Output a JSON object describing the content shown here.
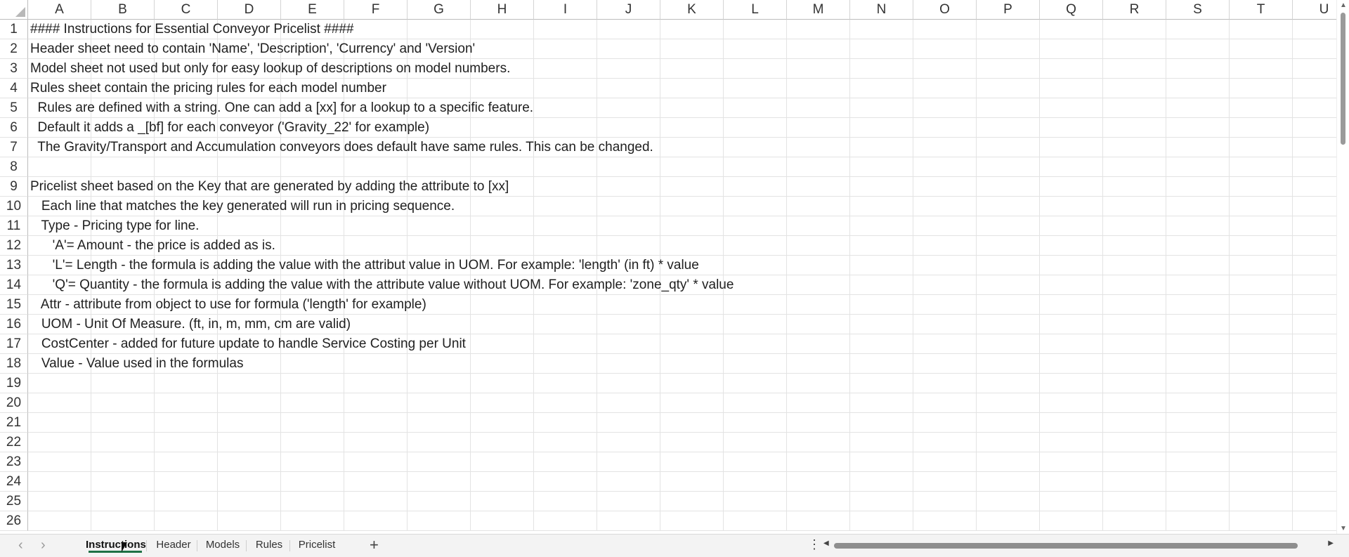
{
  "grid": {
    "columns": [
      "A",
      "B",
      "C",
      "D",
      "E",
      "F",
      "G",
      "H",
      "I",
      "J",
      "K",
      "L",
      "M",
      "N",
      "O",
      "P",
      "Q",
      "R",
      "S",
      "T",
      "U"
    ],
    "rows": [
      {
        "num": "1",
        "text": "#### Instructions for Essential Conveyor Pricelist ####"
      },
      {
        "num": "2",
        "text": "Header sheet need to contain 'Name', 'Description', 'Currency' and 'Version'"
      },
      {
        "num": "3",
        "text": "Model sheet not used but only for easy lookup of descriptions on model numbers."
      },
      {
        "num": "4",
        "text": "Rules sheet contain the pricing rules for each model number"
      },
      {
        "num": "5",
        "text": "  Rules are defined with a string. One can add a [xx] for a lookup to a specific feature."
      },
      {
        "num": "6",
        "text": "  Default it adds a _[bf] for each conveyor ('Gravity_22' for example)"
      },
      {
        "num": "7",
        "text": "  The Gravity/Transport and Accumulation conveyors does default have same rules. This can be changed."
      },
      {
        "num": "8",
        "text": ""
      },
      {
        "num": "9",
        "text": "Pricelist sheet based on the Key that are generated by adding the attribute to [xx]"
      },
      {
        "num": "10",
        "text": "   Each line that matches the key generated will run in pricing sequence."
      },
      {
        "num": "11",
        "text": "   Type - Pricing type for line."
      },
      {
        "num": "12",
        "text": "      'A'= Amount - the price is added as is."
      },
      {
        "num": "13",
        "text": "      'L'= Length - the formula is adding the value with the attribut value in UOM. For example: 'length' (in ft) * value"
      },
      {
        "num": "14",
        "text": "      'Q'= Quantity - the formula is adding the value with the attribute value without UOM. For example: 'zone_qty' * value"
      },
      {
        "num": "15",
        "text": "   Attr - attribute from object to use for formula ('length' for example)"
      },
      {
        "num": "16",
        "text": "   UOM - Unit Of Measure. (ft, in, m, mm, cm are valid)"
      },
      {
        "num": "17",
        "text": "   CostCenter - added for future update to handle Service Costing per Unit"
      },
      {
        "num": "18",
        "text": "   Value - Value used in the formulas"
      },
      {
        "num": "19",
        "text": ""
      },
      {
        "num": "20",
        "text": ""
      },
      {
        "num": "21",
        "text": ""
      },
      {
        "num": "22",
        "text": ""
      },
      {
        "num": "23",
        "text": ""
      },
      {
        "num": "24",
        "text": ""
      },
      {
        "num": "25",
        "text": ""
      },
      {
        "num": "26",
        "text": ""
      }
    ]
  },
  "sheet_tabs": [
    {
      "label": "Instructions",
      "active": true
    },
    {
      "label": "Header",
      "active": false
    },
    {
      "label": "Models",
      "active": false
    },
    {
      "label": "Rules",
      "active": false
    },
    {
      "label": "Pricelist",
      "active": false
    }
  ],
  "icons": {
    "prev_sheet": "chevron-left-icon",
    "next_sheet": "chevron-right-icon",
    "add_sheet": "plus-icon",
    "more": "vertical-dots-icon"
  },
  "colors": {
    "active_tab_underline": "#1e7145"
  }
}
